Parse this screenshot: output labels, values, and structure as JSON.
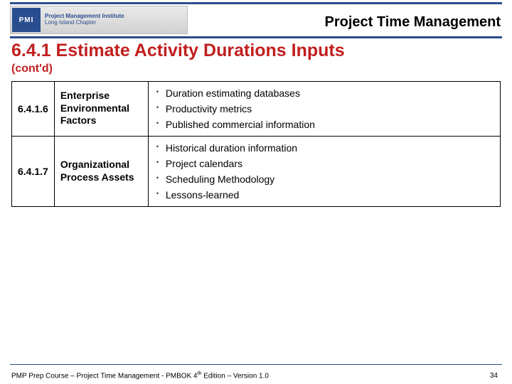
{
  "header": {
    "logo_abbr": "PMI",
    "logo_line1": "Project Management Institute",
    "logo_line2": "Long Island Chapter",
    "title": "Project Time Management"
  },
  "section": {
    "title": "6.4.1 Estimate Activity Durations Inputs",
    "subtitle": "(cont'd)"
  },
  "rows": [
    {
      "idx": "6.4.1.6",
      "name": "Enterprise Environmental Factors",
      "items": [
        "Duration estimating databases",
        "Productivity metrics",
        "Published commercial information"
      ]
    },
    {
      "idx": "6.4.1.7",
      "name": "Organizational Process Assets",
      "items": [
        "Historical duration information",
        "Project calendars",
        "Scheduling Methodology",
        "Lessons-learned"
      ]
    }
  ],
  "footer": {
    "text_pre": "PMP Prep Course – Project Time Management - PMBOK 4",
    "text_sup": "th",
    "text_post": " Edition – Version 1.0",
    "page": "34"
  }
}
